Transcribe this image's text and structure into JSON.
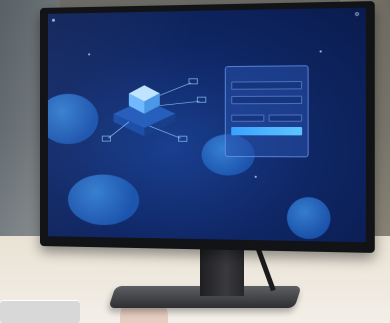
{
  "scene": {
    "screen": {
      "brand_icon": "logo-dot-icon",
      "brand_text": "",
      "lang_icon": "globe-icon",
      "lang_text": "",
      "login": {
        "title": "",
        "username_placeholder": "",
        "password_placeholder": "",
        "captcha_placeholder": "",
        "captcha_code": "",
        "button_label": "",
        "forgot_text": ""
      }
    },
    "colors": {
      "screen_bg": "#0f2766",
      "accent": "#3aa2ff",
      "card_border": "#78aaff"
    }
  }
}
